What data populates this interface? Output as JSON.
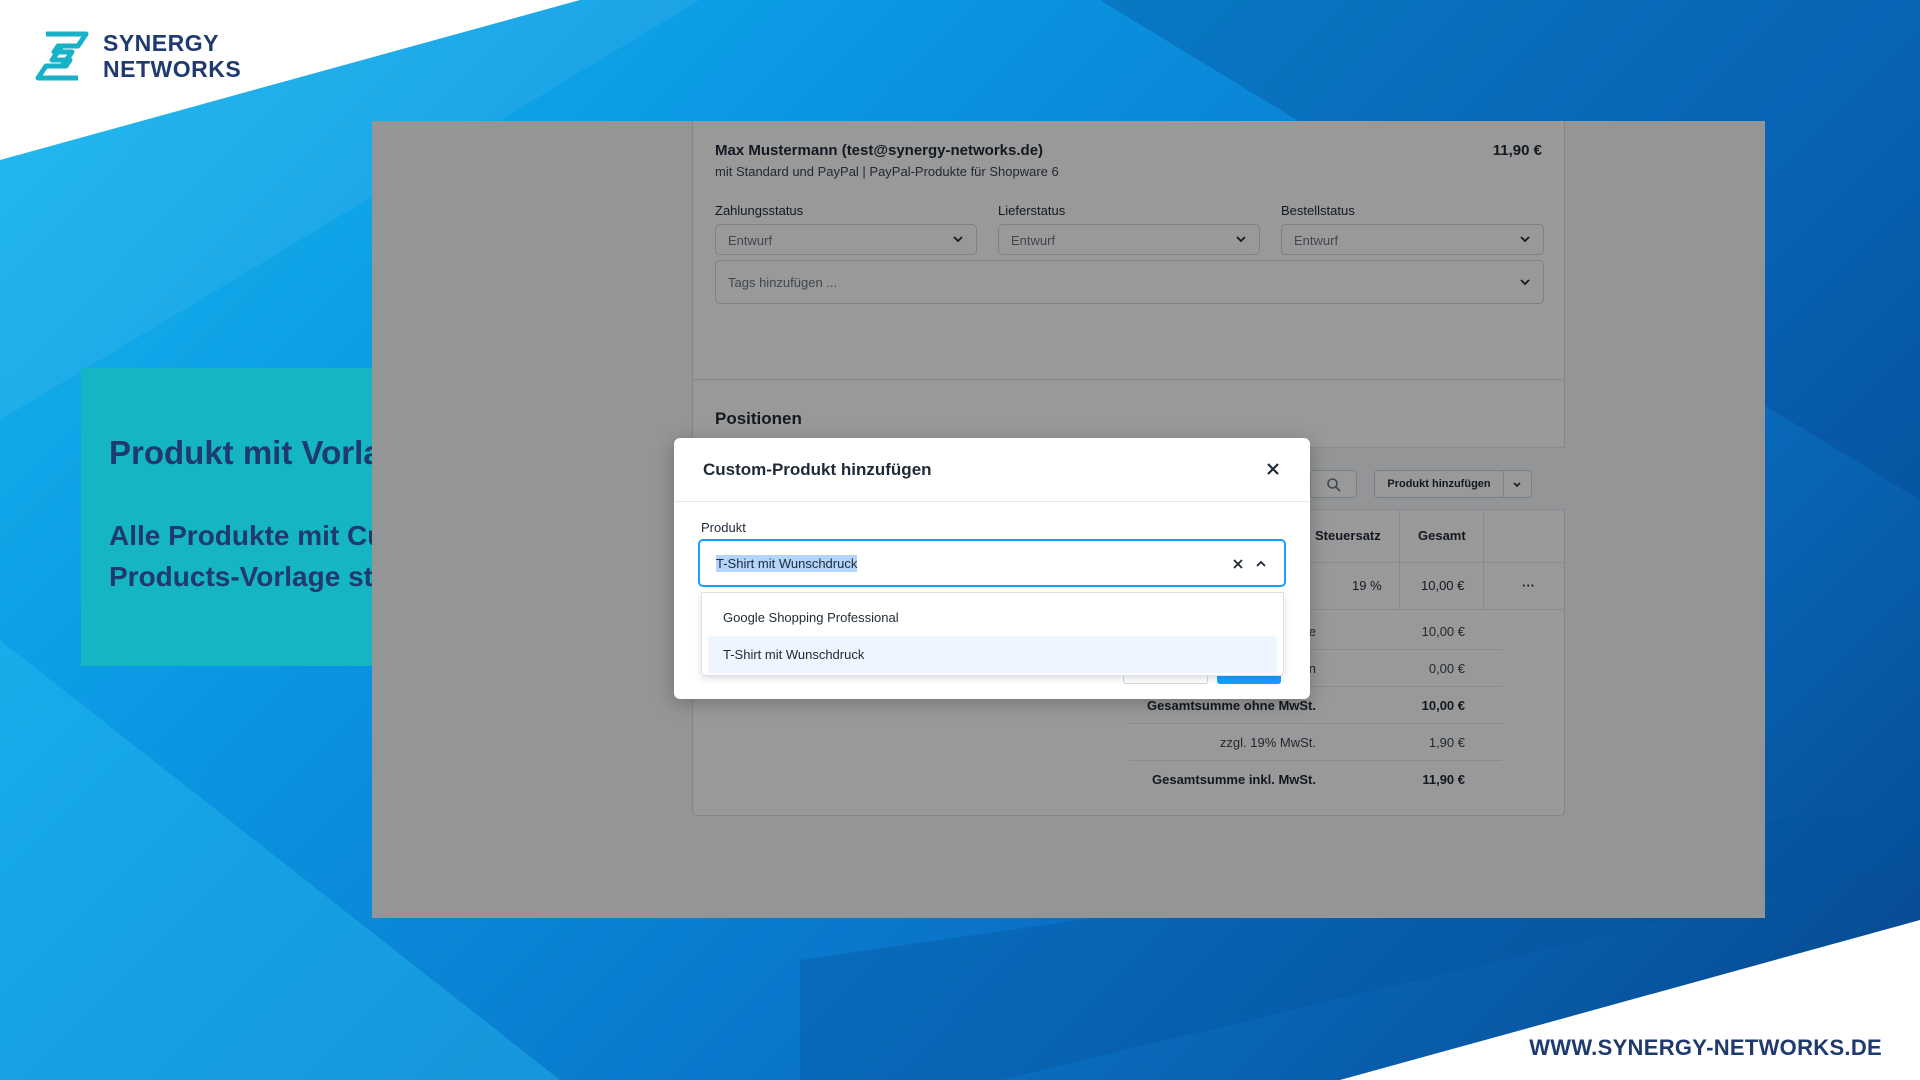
{
  "brand": {
    "line1": "SYNERGY",
    "line2": "NETWORKS",
    "url": "WWW.SYNERGY-NETWORKS.DE"
  },
  "callout": {
    "title": "Produkt mit Vorlage wählen",
    "subtitle": "Alle Produkte mit Custom-Products-Vorlage stehen bereit"
  },
  "order": {
    "customer": "Max Mustermann (test@synergy-networks.de)",
    "details": "mit Standard und PayPal | PayPal-Produkte für Shopware 6",
    "total": "11,90 €",
    "payment_status": {
      "label": "Zahlungsstatus",
      "value": "Entwurf"
    },
    "delivery_status": {
      "label": "Lieferstatus",
      "value": "Entwurf"
    },
    "order_status": {
      "label": "Bestellstatus",
      "value": "Entwurf"
    },
    "tags_placeholder": "Tags hinzufügen ..."
  },
  "positions": {
    "title": "Positionen",
    "add_product_label": "Produkt hinzufügen",
    "columns": {
      "tax": "Steuersatz",
      "total": "Gesamt"
    },
    "row": {
      "tax": "19 %",
      "total": "10,00 €",
      "more": "···"
    },
    "summary": [
      {
        "label": "e",
        "value": "10,00 €",
        "bold": false
      },
      {
        "label": "n",
        "value": "0,00 €",
        "bold": false
      },
      {
        "label": "Gesamtsumme ohne MwSt.",
        "value": "10,00 €",
        "bold": true
      },
      {
        "label": "zzgl. 19% MwSt.",
        "value": "1,90 €",
        "bold": false
      },
      {
        "label": "Gesamtsumme inkl. MwSt.",
        "value": "11,90 €",
        "bold": true
      }
    ]
  },
  "modal": {
    "title": "Custom-Produkt hinzufügen",
    "field_label": "Produkt",
    "selected": "T-Shirt mit Wunschdruck",
    "options": [
      "Google Shopping Professional",
      "T-Shirt mit Wunschdruck"
    ]
  },
  "colors": {
    "accent": "#189eff",
    "brand_text": "#1e3a6e",
    "callout": "#16b5c4"
  }
}
